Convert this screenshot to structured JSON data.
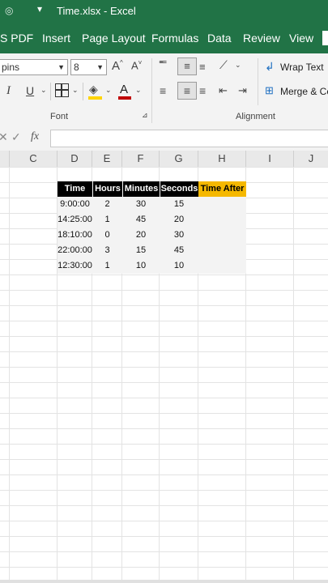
{
  "titlebar": {
    "qat_icon": "qat-icon",
    "qat_dropdown": "▾",
    "title": "Time.xlsx  -  Excel"
  },
  "tabs": [
    "S PDF",
    "Insert",
    "Page Layout",
    "Formulas",
    "Data",
    "Review",
    "View"
  ],
  "ribbon": {
    "font_name": "pins",
    "font_size": "8",
    "grow_font": "A^",
    "shrink_font": "A˅",
    "italic": "I",
    "underline": "U",
    "font_group_label": "Font",
    "wrap_text": "Wrap Text",
    "merge_center": "Merge & Ce",
    "alignment_group_label": "Alignment"
  },
  "formula_bar": {
    "fx": "fx",
    "value": ""
  },
  "columns": [
    "C",
    "D",
    "E",
    "F",
    "G",
    "H",
    "I",
    "J"
  ],
  "table": {
    "headers": [
      "Time",
      "Hours",
      "Minutes",
      "Seconds",
      "Time After"
    ],
    "rows": [
      [
        "9:00:00",
        "2",
        "30",
        "15",
        ""
      ],
      [
        "14:25:00",
        "1",
        "45",
        "20",
        ""
      ],
      [
        "18:10:00",
        "0",
        "20",
        "30",
        ""
      ],
      [
        "22:00:00",
        "3",
        "15",
        "45",
        ""
      ],
      [
        "12:30:00",
        "1",
        "10",
        "10",
        ""
      ]
    ]
  },
  "colors": {
    "excel_green": "#217346",
    "header_black": "#000000",
    "header_yellow": "#f5b800"
  }
}
